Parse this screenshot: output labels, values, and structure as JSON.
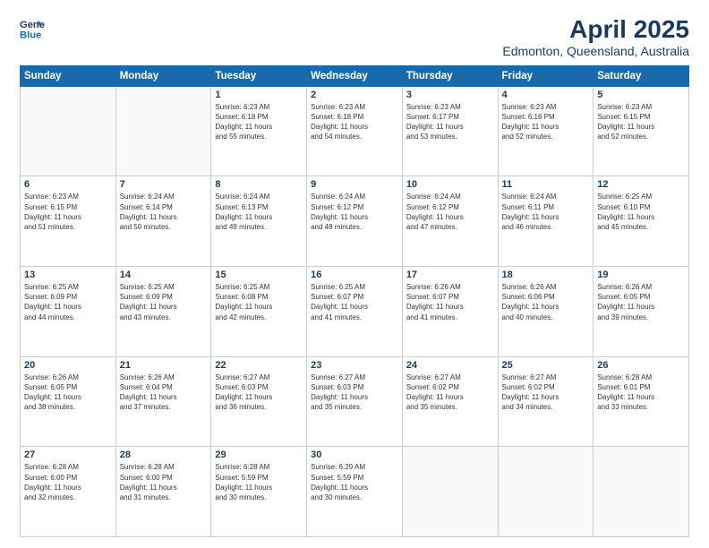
{
  "logo": {
    "line1": "General",
    "line2": "Blue"
  },
  "title": "April 2025",
  "subtitle": "Edmonton, Queensland, Australia",
  "weekdays": [
    "Sunday",
    "Monday",
    "Tuesday",
    "Wednesday",
    "Thursday",
    "Friday",
    "Saturday"
  ],
  "weeks": [
    [
      {
        "day": "",
        "info": ""
      },
      {
        "day": "",
        "info": ""
      },
      {
        "day": "1",
        "info": "Sunrise: 6:23 AM\nSunset: 6:18 PM\nDaylight: 11 hours\nand 55 minutes."
      },
      {
        "day": "2",
        "info": "Sunrise: 6:23 AM\nSunset: 6:18 PM\nDaylight: 11 hours\nand 54 minutes."
      },
      {
        "day": "3",
        "info": "Sunrise: 6:23 AM\nSunset: 6:17 PM\nDaylight: 11 hours\nand 53 minutes."
      },
      {
        "day": "4",
        "info": "Sunrise: 6:23 AM\nSunset: 6:16 PM\nDaylight: 11 hours\nand 52 minutes."
      },
      {
        "day": "5",
        "info": "Sunrise: 6:23 AM\nSunset: 6:15 PM\nDaylight: 11 hours\nand 52 minutes."
      }
    ],
    [
      {
        "day": "6",
        "info": "Sunrise: 6:23 AM\nSunset: 6:15 PM\nDaylight: 11 hours\nand 51 minutes."
      },
      {
        "day": "7",
        "info": "Sunrise: 6:24 AM\nSunset: 6:14 PM\nDaylight: 11 hours\nand 50 minutes."
      },
      {
        "day": "8",
        "info": "Sunrise: 6:24 AM\nSunset: 6:13 PM\nDaylight: 11 hours\nand 49 minutes."
      },
      {
        "day": "9",
        "info": "Sunrise: 6:24 AM\nSunset: 6:12 PM\nDaylight: 11 hours\nand 48 minutes."
      },
      {
        "day": "10",
        "info": "Sunrise: 6:24 AM\nSunset: 6:12 PM\nDaylight: 11 hours\nand 47 minutes."
      },
      {
        "day": "11",
        "info": "Sunrise: 6:24 AM\nSunset: 6:11 PM\nDaylight: 11 hours\nand 46 minutes."
      },
      {
        "day": "12",
        "info": "Sunrise: 6:25 AM\nSunset: 6:10 PM\nDaylight: 11 hours\nand 45 minutes."
      }
    ],
    [
      {
        "day": "13",
        "info": "Sunrise: 6:25 AM\nSunset: 6:09 PM\nDaylight: 11 hours\nand 44 minutes."
      },
      {
        "day": "14",
        "info": "Sunrise: 6:25 AM\nSunset: 6:09 PM\nDaylight: 11 hours\nand 43 minutes."
      },
      {
        "day": "15",
        "info": "Sunrise: 6:25 AM\nSunset: 6:08 PM\nDaylight: 11 hours\nand 42 minutes."
      },
      {
        "day": "16",
        "info": "Sunrise: 6:25 AM\nSunset: 6:07 PM\nDaylight: 11 hours\nand 41 minutes."
      },
      {
        "day": "17",
        "info": "Sunrise: 6:26 AM\nSunset: 6:07 PM\nDaylight: 11 hours\nand 41 minutes."
      },
      {
        "day": "18",
        "info": "Sunrise: 6:26 AM\nSunset: 6:06 PM\nDaylight: 11 hours\nand 40 minutes."
      },
      {
        "day": "19",
        "info": "Sunrise: 6:26 AM\nSunset: 6:05 PM\nDaylight: 11 hours\nand 39 minutes."
      }
    ],
    [
      {
        "day": "20",
        "info": "Sunrise: 6:26 AM\nSunset: 6:05 PM\nDaylight: 11 hours\nand 38 minutes."
      },
      {
        "day": "21",
        "info": "Sunrise: 6:26 AM\nSunset: 6:04 PM\nDaylight: 11 hours\nand 37 minutes."
      },
      {
        "day": "22",
        "info": "Sunrise: 6:27 AM\nSunset: 6:03 PM\nDaylight: 11 hours\nand 36 minutes."
      },
      {
        "day": "23",
        "info": "Sunrise: 6:27 AM\nSunset: 6:03 PM\nDaylight: 11 hours\nand 35 minutes."
      },
      {
        "day": "24",
        "info": "Sunrise: 6:27 AM\nSunset: 6:02 PM\nDaylight: 11 hours\nand 35 minutes."
      },
      {
        "day": "25",
        "info": "Sunrise: 6:27 AM\nSunset: 6:02 PM\nDaylight: 11 hours\nand 34 minutes."
      },
      {
        "day": "26",
        "info": "Sunrise: 6:28 AM\nSunset: 6:01 PM\nDaylight: 11 hours\nand 33 minutes."
      }
    ],
    [
      {
        "day": "27",
        "info": "Sunrise: 6:28 AM\nSunset: 6:00 PM\nDaylight: 11 hours\nand 32 minutes."
      },
      {
        "day": "28",
        "info": "Sunrise: 6:28 AM\nSunset: 6:00 PM\nDaylight: 11 hours\nand 31 minutes."
      },
      {
        "day": "29",
        "info": "Sunrise: 6:28 AM\nSunset: 5:59 PM\nDaylight: 11 hours\nand 30 minutes."
      },
      {
        "day": "30",
        "info": "Sunrise: 6:29 AM\nSunset: 5:59 PM\nDaylight: 11 hours\nand 30 minutes."
      },
      {
        "day": "",
        "info": ""
      },
      {
        "day": "",
        "info": ""
      },
      {
        "day": "",
        "info": ""
      }
    ]
  ]
}
